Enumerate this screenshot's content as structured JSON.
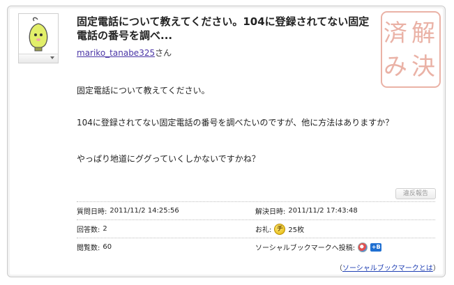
{
  "question": {
    "title": "固定電話について教えてください。104に登録されてない固定電話の番号を調べ...",
    "asker_name": "mariko_tanabe325",
    "asker_suffix": "さん",
    "body": [
      "固定電話について教えてください。",
      "104に登録されてない固定電話の番号を調べたいのですが、他に方法はありますか？",
      "やっぱり地道にググっていくしかないですかね？"
    ],
    "stamp_text": [
      "解",
      "決",
      "済",
      "み"
    ]
  },
  "report_button": "違反報告",
  "info": {
    "asked_label": "質問日時:",
    "asked_value": "2011/11/2 14:25:56",
    "resolved_label": "解決日時:",
    "resolved_value": "2011/11/2 17:43:48",
    "answers_label": "回答数:",
    "answers_value": "2",
    "reward_label": "お礼:",
    "reward_coin": "チ",
    "reward_value": "25枚",
    "views_label": "閲覧数:",
    "views_value": "60",
    "bookmark_label": "ソーシャルブックマークへ投稿:",
    "bookmark_icon2": "+B"
  },
  "bookmark_help": {
    "open": "（",
    "link": "ソーシャルブックマークとは",
    "close": "）"
  },
  "colors": {
    "link": "#4a35a6",
    "stamp": "#e8a89a",
    "coin": "#e2b400"
  },
  "icons": {
    "avatar": "bulb-character-icon",
    "dropdown": "chevron-down-icon",
    "coin": "chiebukuro-coin-icon",
    "bookmark1": "bookmark-service-icon",
    "bookmark2": "hatena-bookmark-icon"
  }
}
